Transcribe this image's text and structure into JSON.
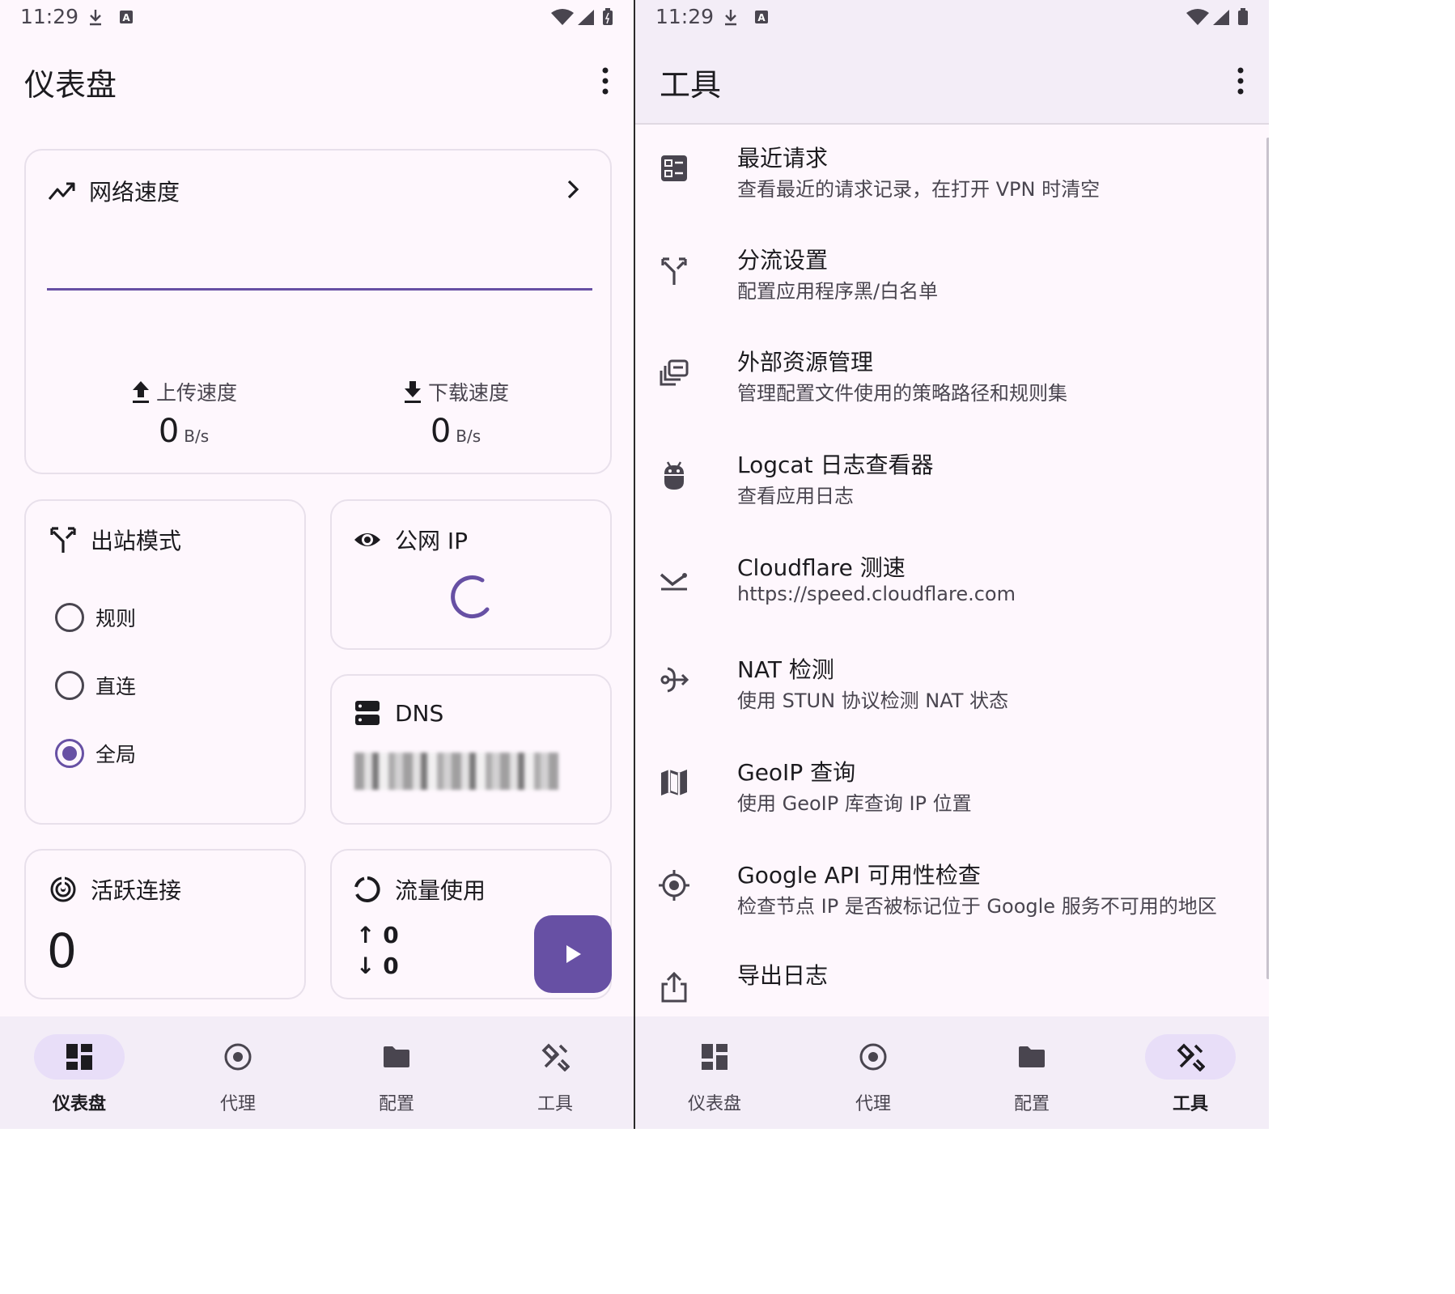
{
  "status_bar": {
    "time": "11:29"
  },
  "left": {
    "title": "仪表盘",
    "network_speed": {
      "title": "网络速度",
      "upload_label": "上传速度",
      "upload_value": "0",
      "upload_unit": "B/s",
      "download_label": "下载速度",
      "download_value": "0",
      "download_unit": "B/s"
    },
    "outbound": {
      "title": "出站模式",
      "options": [
        "规则",
        "直连",
        "全局"
      ],
      "selected": "全局"
    },
    "public_ip": {
      "title": "公网 IP"
    },
    "dns": {
      "title": "DNS"
    },
    "active_connections": {
      "title": "活跃连接",
      "value": "0"
    },
    "traffic": {
      "title": "流量使用",
      "up": "0",
      "down": "0",
      "up_arrow": "↑",
      "down_arrow": "↓"
    }
  },
  "right": {
    "title": "工具",
    "items": [
      {
        "title": "最近请求",
        "subtitle": "查看最近的请求记录，在打开 VPN 时清空",
        "icon": "list-box-icon"
      },
      {
        "title": "分流设置",
        "subtitle": "配置应用程序黑/白名单",
        "icon": "call-split-icon"
      },
      {
        "title": "外部资源管理",
        "subtitle": "管理配置文件使用的策略路径和规则集",
        "icon": "library-icon"
      },
      {
        "title": "Logcat 日志查看器",
        "subtitle": "查看应用日志",
        "icon": "bug-icon"
      },
      {
        "title": "Cloudflare 测速",
        "subtitle": "https://speed.cloudflare.com",
        "icon": "speed-icon"
      },
      {
        "title": "NAT 检测",
        "subtitle": "使用 STUN 协议检测 NAT 状态",
        "icon": "nat-icon"
      },
      {
        "title": "GeoIP 查询",
        "subtitle": "使用 GeoIP 库查询 IP 位置",
        "icon": "map-icon"
      },
      {
        "title": "Google API 可用性检查",
        "subtitle": "检查节点 IP 是否被标记位于 Google 服务不可用的地区",
        "icon": "gps-icon"
      },
      {
        "title": "导出日志",
        "subtitle": "",
        "icon": "share-icon"
      }
    ]
  },
  "nav": [
    {
      "label": "仪表盘",
      "icon": "dashboard-icon"
    },
    {
      "label": "代理",
      "icon": "proxy-icon"
    },
    {
      "label": "配置",
      "icon": "folder-icon"
    },
    {
      "label": "工具",
      "icon": "tools-icon"
    }
  ],
  "colors": {
    "accent": "#6750a4",
    "surface": "#fef7fd",
    "nav_bg": "#f3edf7",
    "pill": "#e8def8"
  }
}
